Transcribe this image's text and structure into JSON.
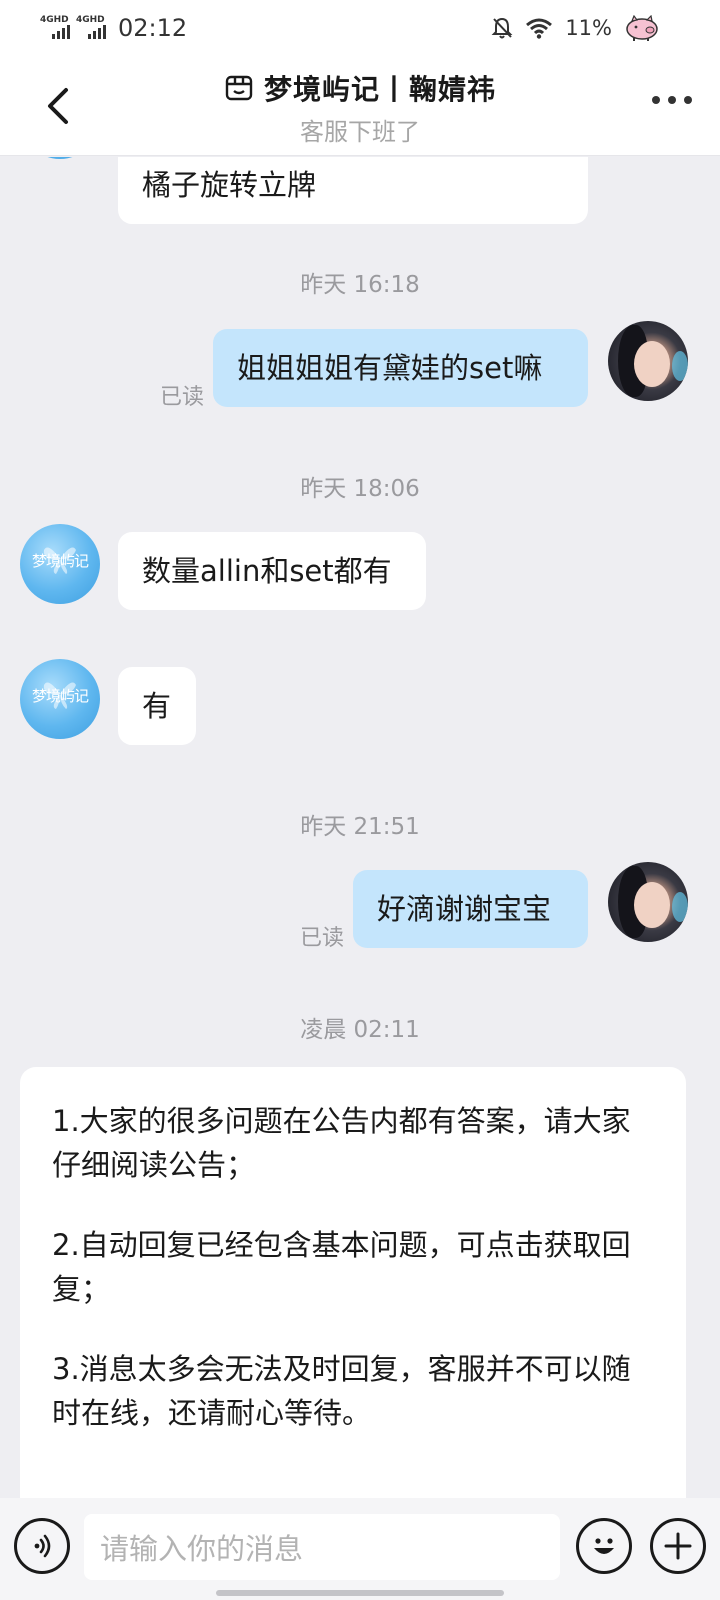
{
  "status_bar": {
    "network_1": "4GHD",
    "network_2": "4GHD",
    "time": "02:12",
    "battery": "11%",
    "icons": [
      "mute-bell-icon",
      "wifi-icon",
      "pig-icon"
    ]
  },
  "header": {
    "title": "梦境屿记丨鞠婧祎",
    "subtitle": "客服下班了",
    "icons": [
      "back-icon",
      "shop-icon",
      "more-icon"
    ]
  },
  "messages": {
    "top_partial": "橘子旋转立牌",
    "ts_1": "昨天 16:18",
    "out_1": "姐姐姐姐有黛娃的set嘛",
    "read_1": "已读",
    "ts_2": "昨天 18:06",
    "in_1": "数量allin和set都有",
    "in_2": "有",
    "ts_3": "昨天 21:51",
    "out_2": "好滴谢谢宝宝",
    "read_2": "已读",
    "ts_4": "凌晨 02:11",
    "shop_avatar_text": "梦境屿记"
  },
  "notice": {
    "p1": "1.大家的很多问题在公告内都有答案，请大家仔细阅读公告；",
    "p2": "2.自动回复已经包含基本问题，可点击获取回复；",
    "p3": "3.消息太多会无法及时回复，客服并不可以随时在线，还请耐心等待。"
  },
  "input_bar": {
    "placeholder": "请输入你的消息",
    "icons": [
      "voice-icon",
      "emoji-icon",
      "plus-icon"
    ]
  },
  "colors": {
    "background": "#eeeef2",
    "outgoing_bubble": "#c4e5fc",
    "incoming_bubble": "#ffffff"
  }
}
